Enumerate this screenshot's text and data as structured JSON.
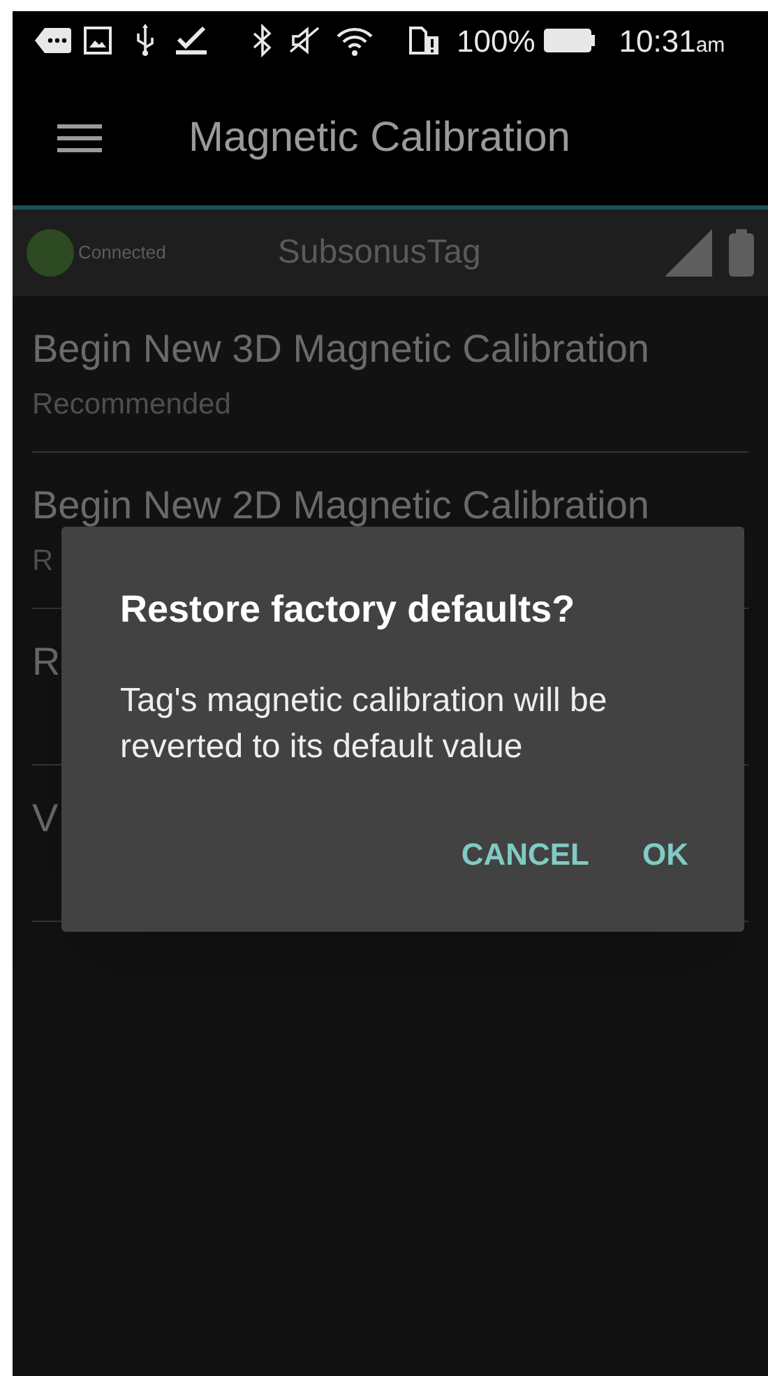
{
  "status_bar": {
    "battery": "100%",
    "time": "10:31",
    "time_suffix": "am"
  },
  "app_bar": {
    "title": "Magnetic Calibration"
  },
  "device": {
    "connected": true,
    "status": "Connected",
    "name": "SubsonusTag"
  },
  "items": [
    {
      "title": "Begin New 3D Magnetic Calibration",
      "subtitle": "Recommended"
    },
    {
      "title": "Begin New 2D Magnetic Calibration",
      "subtitle": "R"
    },
    {
      "title": "R"
    },
    {
      "title": "V"
    }
  ],
  "dialog": {
    "title": "Restore factory defaults?",
    "message": "Tag's magnetic calibration will be reverted to its default value",
    "buttons": [
      "CANCEL",
      "OK"
    ]
  }
}
